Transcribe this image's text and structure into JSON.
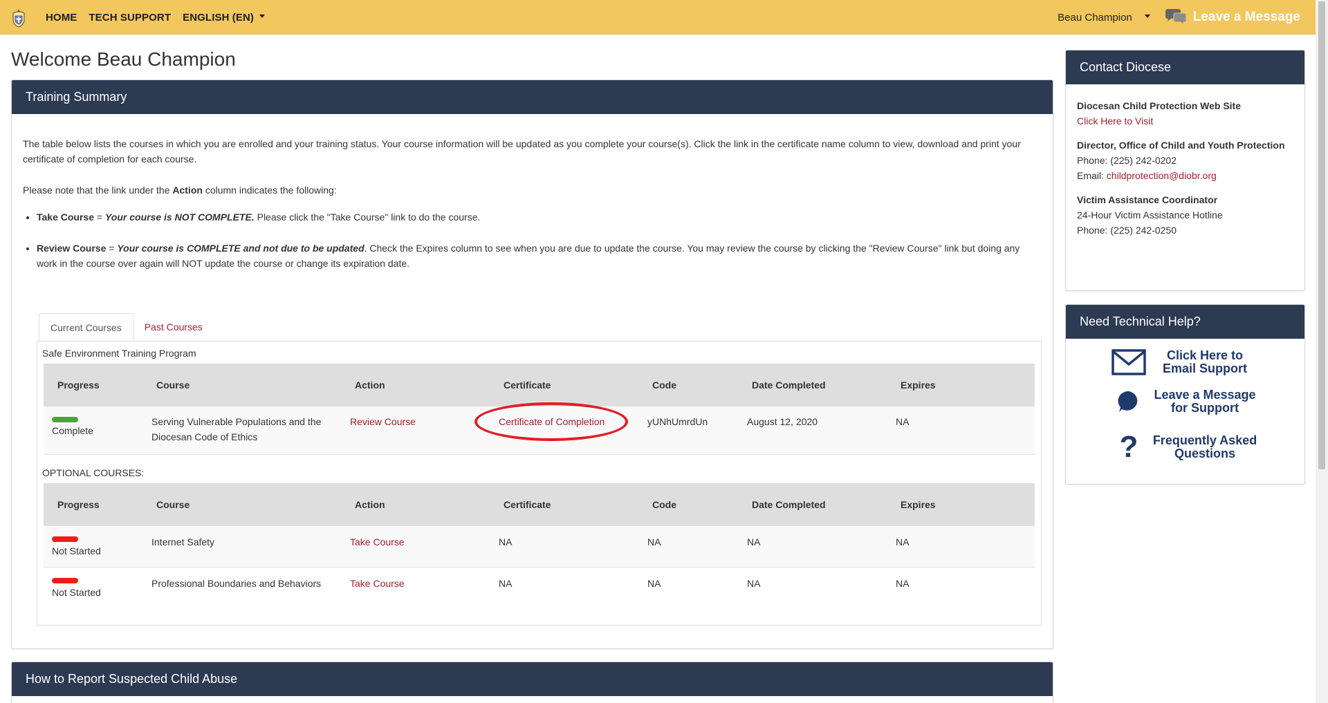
{
  "nav": {
    "home": "HOME",
    "tech_support": "TECH SUPPORT",
    "language": "ENGLISH (EN)",
    "user": "Beau Champion",
    "leave_message": "Leave a Message"
  },
  "welcome": "Welcome Beau Champion",
  "training": {
    "title": "Training Summary",
    "intro": "The table below lists the courses in which you are enrolled and your training status. Your course information will be updated as you complete your course(s). Click the link in the certificate name column to view, download and print your certificate of completion for each course.",
    "note_prefix": "Please note that the link under the ",
    "note_bold": "Action",
    "note_suffix": " column indicates the following:",
    "bullet1_term": "Take Course",
    "bullet1_eq": " = ",
    "bullet1_em": "Your course is NOT COMPLETE.",
    "bullet1_rest": " Please click the \"Take Course\" link to do the course.",
    "bullet2_term": "Review Course",
    "bullet2_eq": " = ",
    "bullet2_em": "Your course is COMPLETE and not due to be updated",
    "bullet2_rest": ". Check the Expires column to see when you are due to update the course. You may review the course by clicking the \"Review Course\" link but doing any work in the course over again will NOT update the course or change its expiration date.",
    "tabs": [
      "Current Courses",
      "Past Courses"
    ],
    "program_title": "Safe Environment Training Program",
    "optional_label": "OPTIONAL COURSES:",
    "columns": [
      "Progress",
      "Course",
      "Action",
      "Certificate",
      "Code",
      "Date Completed",
      "Expires"
    ],
    "main_rows": [
      {
        "status_color": "#4ca62d",
        "progress": "Complete",
        "course_line1": "Serving Vulnerable Populations and the",
        "course_line2": "Diocesan Code of Ethics",
        "action": "Review Course",
        "certificate": "Certificate of Completion",
        "code": "yUNhUmrdUn",
        "date": "August 12, 2020",
        "expires": "NA"
      }
    ],
    "optional_rows": [
      {
        "status_color": "#ee1c1c",
        "progress": "Not Started",
        "course": "Internet Safety",
        "action": "Take Course",
        "certificate": "NA",
        "code": "NA",
        "date": "NA",
        "expires": "NA"
      },
      {
        "status_color": "#ee1c1c",
        "progress": "Not Started",
        "course": "Professional Boundaries and Behaviors",
        "action": "Take Course",
        "certificate": "NA",
        "code": "NA",
        "date": "NA",
        "expires": "NA"
      }
    ]
  },
  "contact": {
    "title": "Contact Diocese",
    "site_title": "Diocesan Child Protection Web Site",
    "site_link": "Click Here to Visit",
    "director_title": "Director, Office of Child and Youth Protection",
    "director_phone": "Phone: (225) 242-0202",
    "director_email_label": "Email: ",
    "director_email": "childprotection@diobr.org",
    "victim_title": "Victim Assistance Coordinator",
    "victim_hotline": "24-Hour Victim Assistance Hotline",
    "victim_phone": "Phone: (225) 242-0250"
  },
  "help": {
    "title": "Need Technical Help?",
    "email_l1": "Click Here to",
    "email_l2": "Email Support",
    "msg_l1": "Leave a Message",
    "msg_l2": "for Support",
    "faq_l1": "Frequently Asked",
    "faq_l2": "Questions"
  },
  "howto": {
    "title": "How to Report Suspected Child Abuse"
  },
  "colors": {
    "navbar": "#f2c75e",
    "panel_header": "#2c3a52",
    "link": "#a21f2d",
    "help_text": "#1e3a6b",
    "annotation_ring": "#e01f25"
  }
}
